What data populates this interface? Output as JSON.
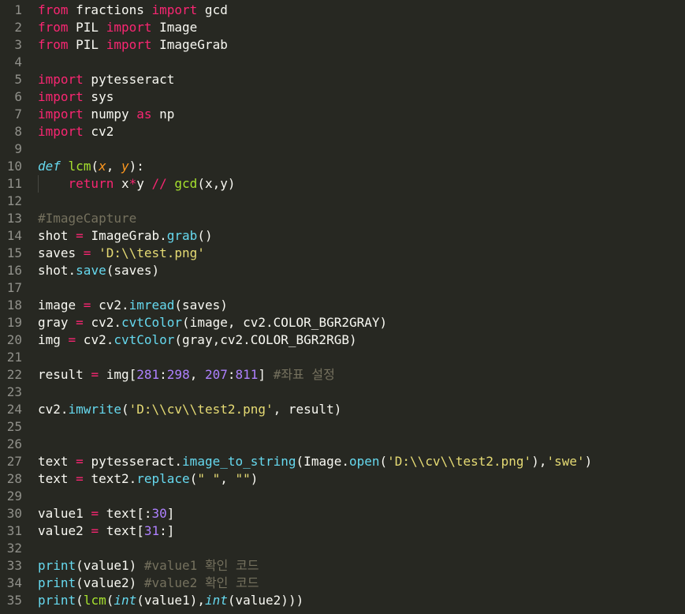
{
  "colors": {
    "background": "#272822",
    "gutter_text": "#90908a",
    "plain": "#f8f8f2",
    "keyword": "#f92672",
    "function": "#a6e22e",
    "builtin": "#66d9ef",
    "param": "#fd971f",
    "string": "#e6db74",
    "number": "#ae81ff",
    "comment": "#75715e"
  },
  "lines": [
    [
      [
        "kw",
        "from"
      ],
      [
        "p",
        " fractions "
      ],
      [
        "kw",
        "import"
      ],
      [
        "p",
        " gcd"
      ]
    ],
    [
      [
        "kw",
        "from"
      ],
      [
        "p",
        " PIL "
      ],
      [
        "kw",
        "import"
      ],
      [
        "p",
        " Image"
      ]
    ],
    [
      [
        "kw",
        "from"
      ],
      [
        "p",
        " PIL "
      ],
      [
        "kw",
        "import"
      ],
      [
        "p",
        " ImageGrab"
      ]
    ],
    [],
    [
      [
        "kw",
        "import"
      ],
      [
        "p",
        " pytesseract"
      ]
    ],
    [
      [
        "kw",
        "import"
      ],
      [
        "p",
        " sys"
      ]
    ],
    [
      [
        "kw",
        "import"
      ],
      [
        "p",
        " numpy "
      ],
      [
        "kw",
        "as"
      ],
      [
        "p",
        " np"
      ]
    ],
    [
      [
        "kw",
        "import"
      ],
      [
        "p",
        " cv2"
      ]
    ],
    [],
    [
      [
        "def",
        "def"
      ],
      [
        "p",
        " "
      ],
      [
        "fn",
        "lcm"
      ],
      [
        "p",
        "("
      ],
      [
        "param",
        "x"
      ],
      [
        "p",
        ", "
      ],
      [
        "param",
        "y"
      ],
      [
        "p",
        "):"
      ]
    ],
    [
      [
        "p",
        "    "
      ],
      [
        "kw",
        "return"
      ],
      [
        "p",
        " x"
      ],
      [
        "op",
        "*"
      ],
      [
        "p",
        "y "
      ],
      [
        "op",
        "//"
      ],
      [
        "p",
        " "
      ],
      [
        "fn",
        "gcd"
      ],
      [
        "p",
        "(x,y)"
      ]
    ],
    [],
    [
      [
        "cm",
        "#ImageCapture"
      ]
    ],
    [
      [
        "p",
        "shot "
      ],
      [
        "op",
        "="
      ],
      [
        "p",
        " ImageGrab."
      ],
      [
        "builtin",
        "grab"
      ],
      [
        "p",
        "()"
      ]
    ],
    [
      [
        "p",
        "saves "
      ],
      [
        "op",
        "="
      ],
      [
        "p",
        " "
      ],
      [
        "str",
        "'D:\\\\test.png'"
      ]
    ],
    [
      [
        "p",
        "shot."
      ],
      [
        "builtin",
        "save"
      ],
      [
        "p",
        "(saves)"
      ]
    ],
    [],
    [
      [
        "p",
        "image "
      ],
      [
        "op",
        "="
      ],
      [
        "p",
        " cv2."
      ],
      [
        "builtin",
        "imread"
      ],
      [
        "p",
        "(saves)"
      ]
    ],
    [
      [
        "p",
        "gray "
      ],
      [
        "op",
        "="
      ],
      [
        "p",
        " cv2."
      ],
      [
        "builtin",
        "cvtColor"
      ],
      [
        "p",
        "(image, cv2.COLOR_BGR2GRAY)"
      ]
    ],
    [
      [
        "p",
        "img "
      ],
      [
        "op",
        "="
      ],
      [
        "p",
        " cv2."
      ],
      [
        "builtin",
        "cvtColor"
      ],
      [
        "p",
        "(gray,cv2.COLOR_BGR2RGB)"
      ]
    ],
    [],
    [
      [
        "p",
        "result "
      ],
      [
        "op",
        "="
      ],
      [
        "p",
        " img["
      ],
      [
        "num",
        "281"
      ],
      [
        "p",
        ":"
      ],
      [
        "num",
        "298"
      ],
      [
        "p",
        ", "
      ],
      [
        "num",
        "207"
      ],
      [
        "p",
        ":"
      ],
      [
        "num",
        "811"
      ],
      [
        "p",
        "] "
      ],
      [
        "cm",
        "#좌표 설정"
      ]
    ],
    [],
    [
      [
        "p",
        "cv2."
      ],
      [
        "builtin",
        "imwrite"
      ],
      [
        "p",
        "("
      ],
      [
        "str",
        "'D:\\\\cv\\\\test2.png'"
      ],
      [
        "p",
        ", result)"
      ]
    ],
    [],
    [],
    [
      [
        "p",
        "text "
      ],
      [
        "op",
        "="
      ],
      [
        "p",
        " pytesseract."
      ],
      [
        "builtin",
        "image_to_string"
      ],
      [
        "p",
        "(Image."
      ],
      [
        "builtin",
        "open"
      ],
      [
        "p",
        "("
      ],
      [
        "str",
        "'D:\\\\cv\\\\test2.png'"
      ],
      [
        "p",
        "),"
      ],
      [
        "str",
        "'swe'"
      ],
      [
        "p",
        ")"
      ]
    ],
    [
      [
        "p",
        "text "
      ],
      [
        "op",
        "="
      ],
      [
        "p",
        " text2."
      ],
      [
        "builtin",
        "replace"
      ],
      [
        "p",
        "("
      ],
      [
        "str",
        "\" \""
      ],
      [
        "p",
        ", "
      ],
      [
        "str",
        "\"\""
      ],
      [
        "p",
        ")"
      ]
    ],
    [],
    [
      [
        "p",
        "value1 "
      ],
      [
        "op",
        "="
      ],
      [
        "p",
        " text[:"
      ],
      [
        "num",
        "30"
      ],
      [
        "p",
        "]"
      ]
    ],
    [
      [
        "p",
        "value2 "
      ],
      [
        "op",
        "="
      ],
      [
        "p",
        " text["
      ],
      [
        "num",
        "31"
      ],
      [
        "p",
        ":]"
      ]
    ],
    [],
    [
      [
        "builtin",
        "print"
      ],
      [
        "p",
        "(value1) "
      ],
      [
        "cm",
        "#value1 확인 코드"
      ]
    ],
    [
      [
        "builtin",
        "print"
      ],
      [
        "p",
        "(value2) "
      ],
      [
        "cm",
        "#value2 확인 코드"
      ]
    ],
    [
      [
        "builtin",
        "print"
      ],
      [
        "p",
        "("
      ],
      [
        "fn",
        "lcm"
      ],
      [
        "p",
        "("
      ],
      [
        "type",
        "int"
      ],
      [
        "p",
        "(value1),"
      ],
      [
        "type",
        "int"
      ],
      [
        "p",
        "(value2)))"
      ]
    ]
  ]
}
